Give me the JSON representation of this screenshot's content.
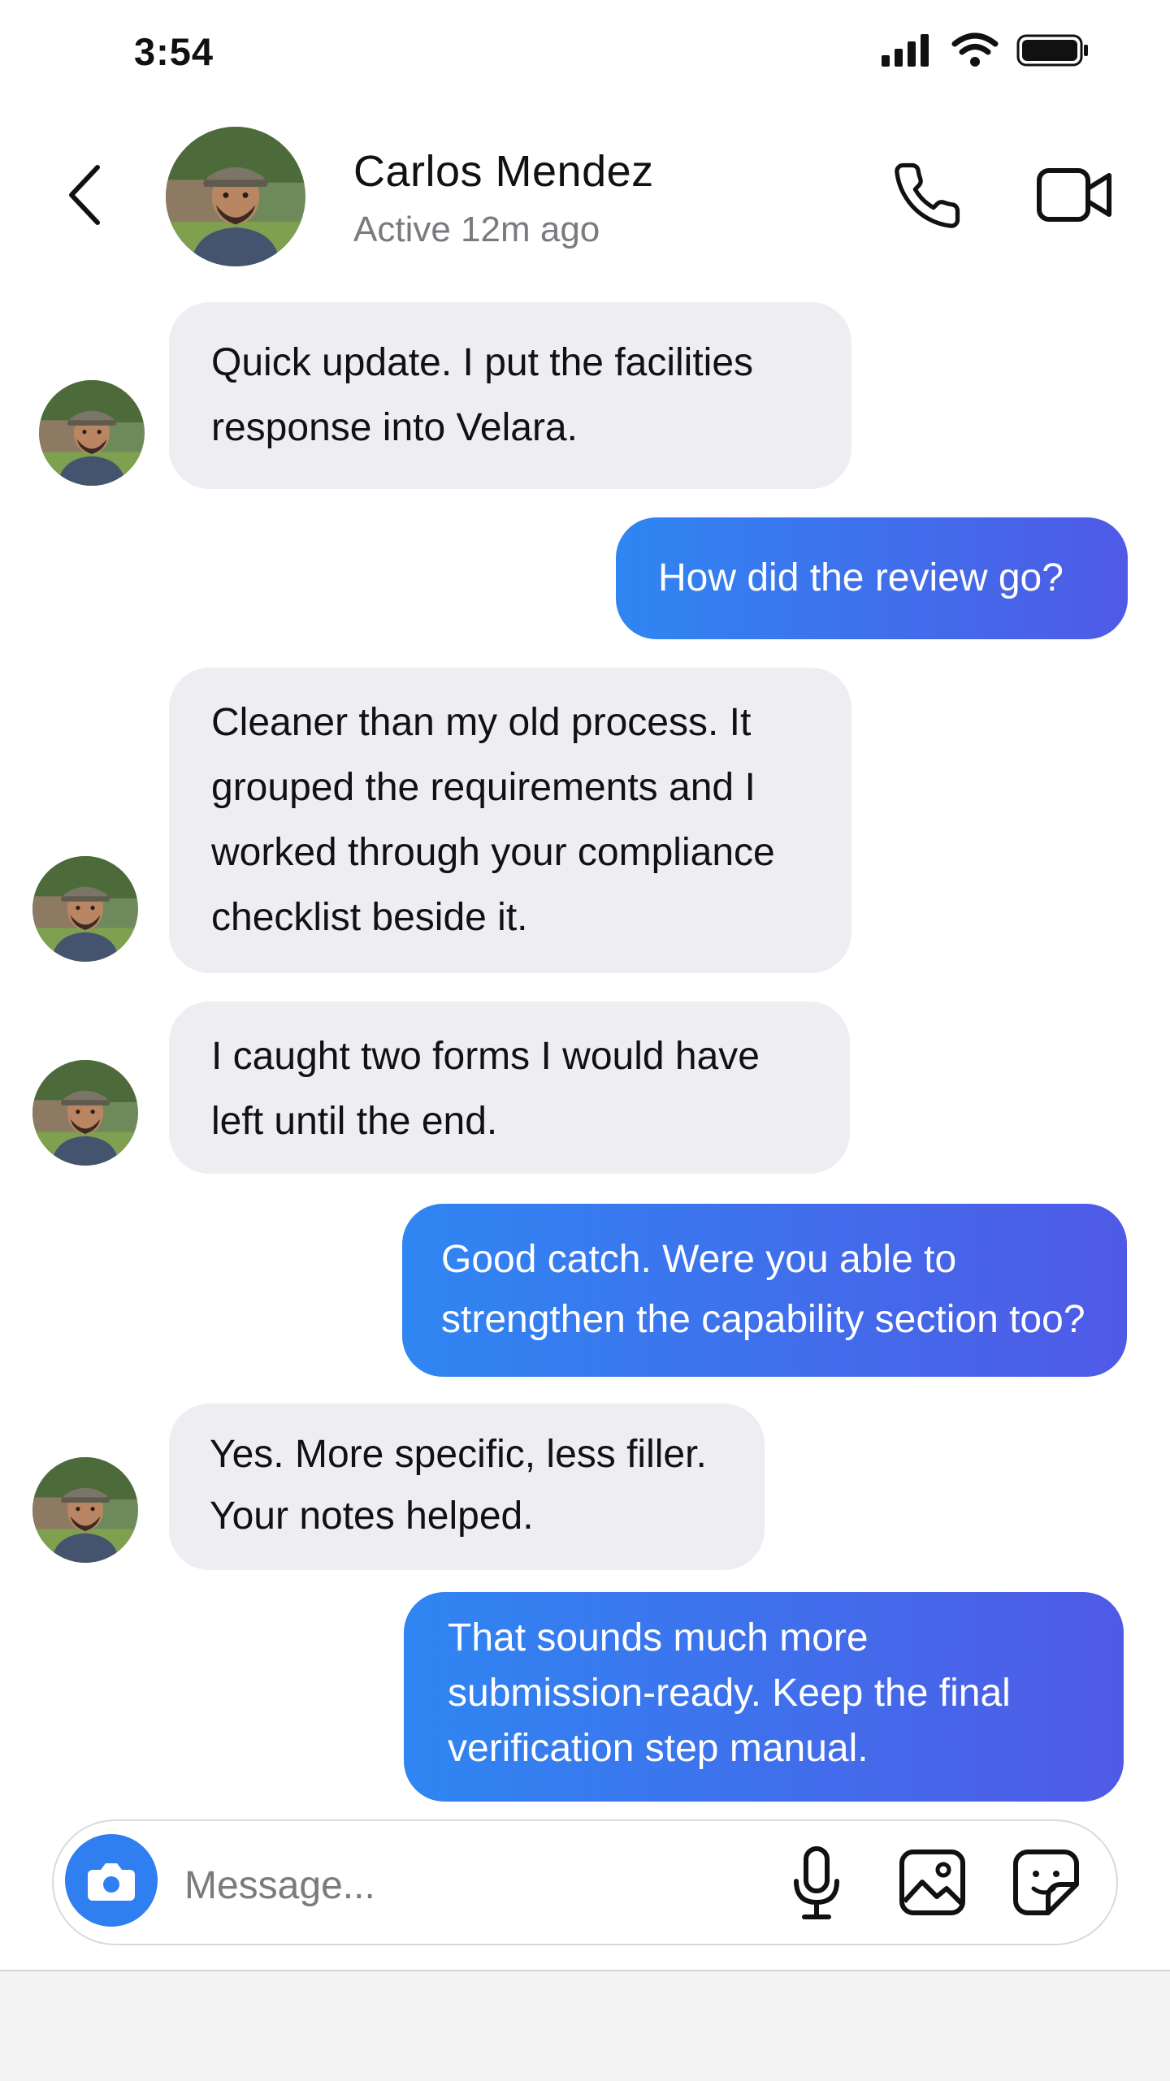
{
  "status_bar": {
    "time": "3:54"
  },
  "header": {
    "contact_name": "Carlos Mendez",
    "presence": "Active 12m ago"
  },
  "messages": [
    {
      "direction": "incoming",
      "lines": [
        "Quick update. I put the facilities",
        "response into Velara."
      ]
    },
    {
      "direction": "outgoing",
      "lines": [
        "How did the review go?"
      ]
    },
    {
      "direction": "incoming",
      "lines": [
        "Cleaner than my old process. It",
        "grouped the requirements and I",
        "worked through your compliance",
        "checklist beside it."
      ]
    },
    {
      "direction": "incoming",
      "lines": [
        "I caught two forms I would have",
        "left until the end."
      ]
    },
    {
      "direction": "outgoing",
      "lines": [
        "Good catch. Were you able to",
        "strengthen the capability section too?"
      ]
    },
    {
      "direction": "incoming",
      "lines": [
        "Yes. More specific, less filler.",
        "Your notes helped."
      ]
    },
    {
      "direction": "outgoing",
      "lines": [
        "That sounds much more",
        "submission-ready. Keep the final",
        "verification step manual."
      ]
    }
  ],
  "composer": {
    "placeholder": "Message..."
  },
  "icons": {
    "back": "chevron-left-icon",
    "call": "phone-icon",
    "video": "video-camera-icon",
    "camera": "camera-icon",
    "mic": "microphone-icon",
    "gallery": "image-icon",
    "sticker": "sticker-icon"
  },
  "colors": {
    "incoming_bubble": "#ededf2",
    "outgoing_gradient_start": "#2f86f2",
    "outgoing_gradient_end": "#4f5ae6",
    "camera_button": "#2f7ff0"
  }
}
